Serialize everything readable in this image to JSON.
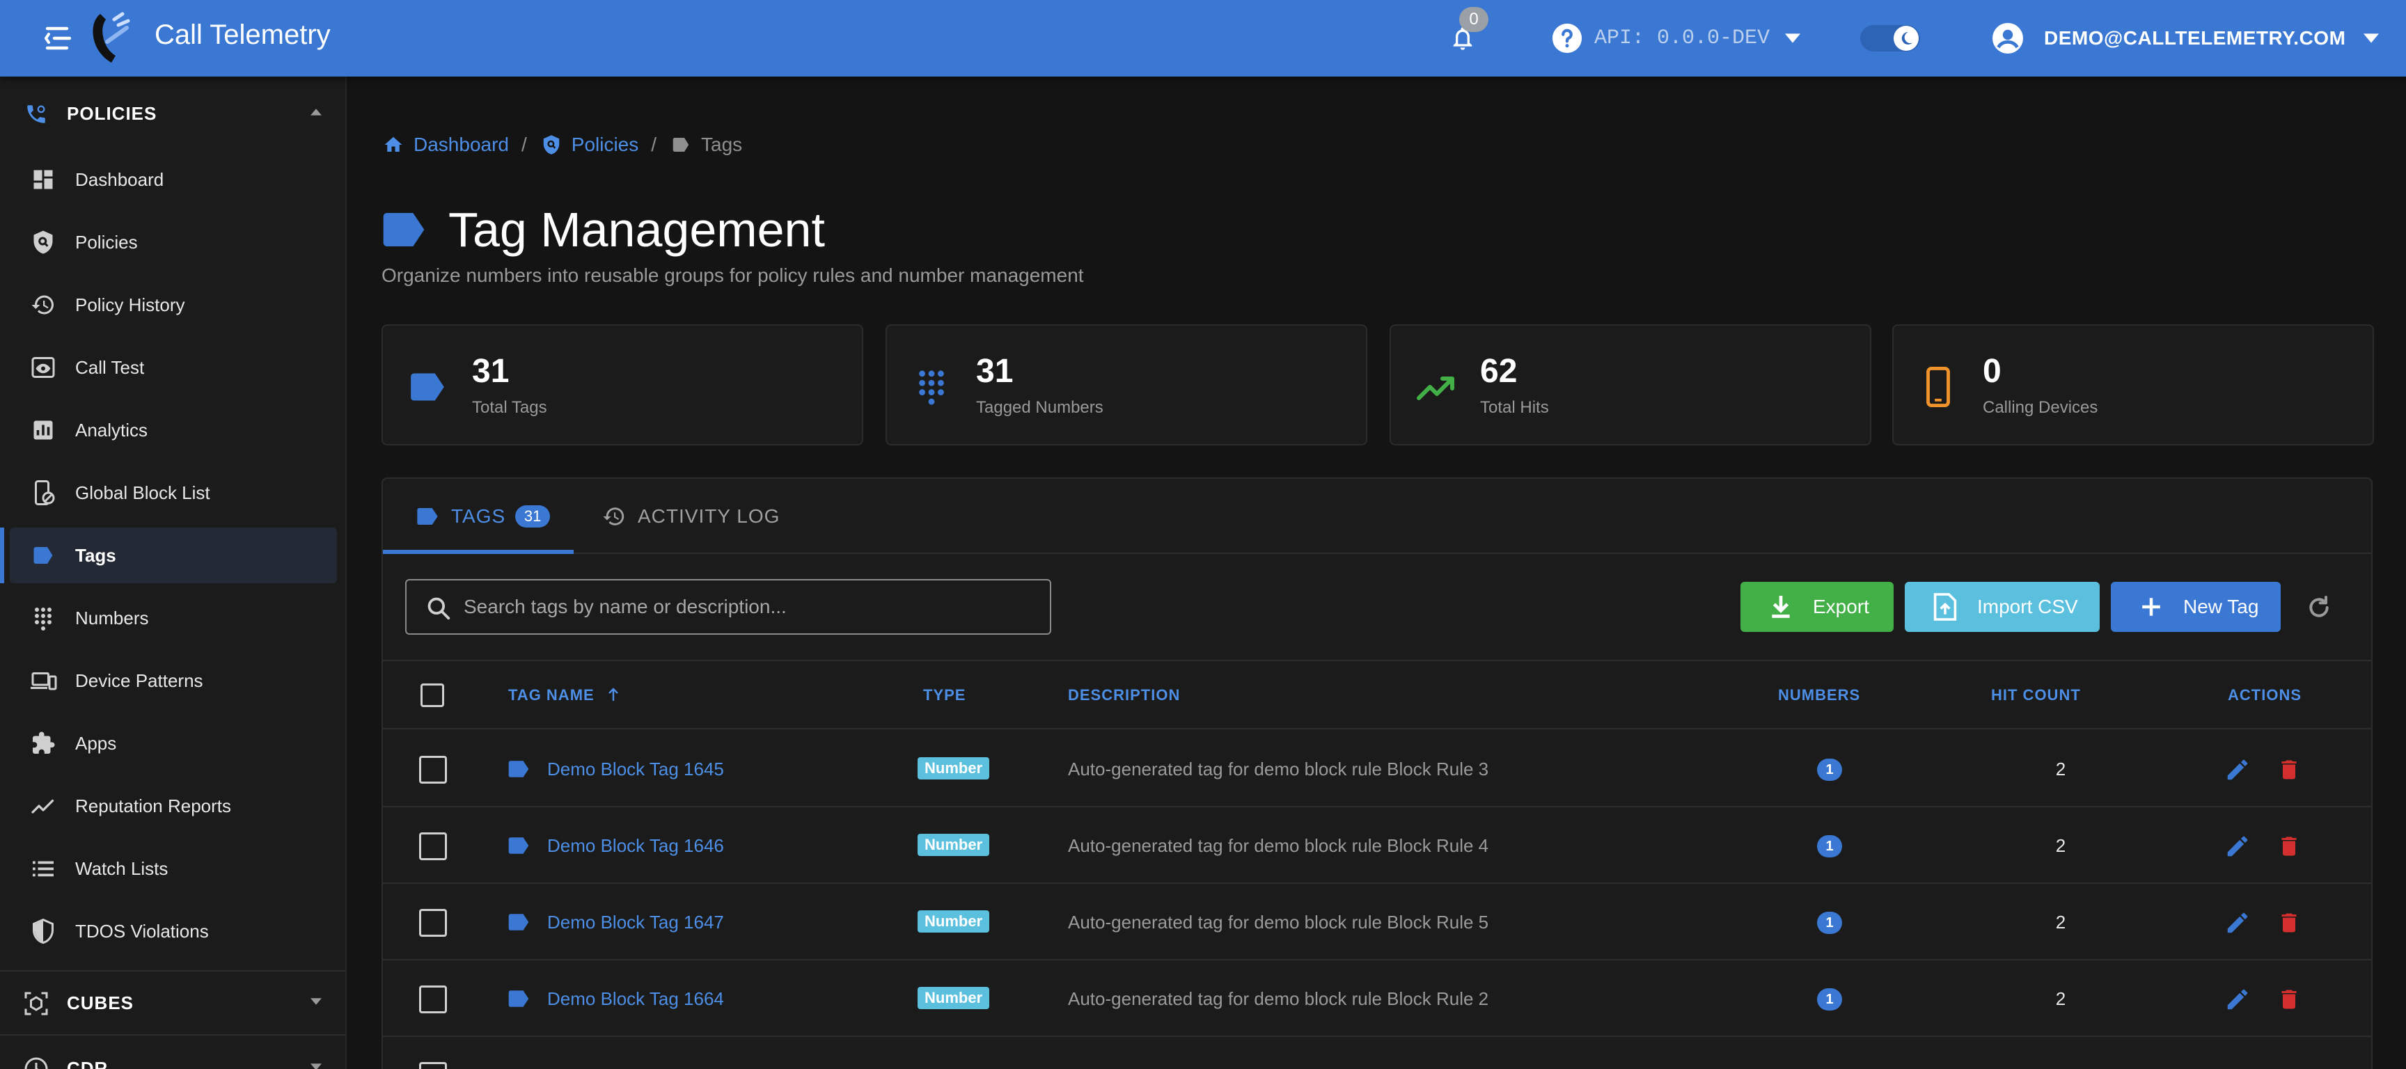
{
  "app": {
    "title": "Call Telemetry",
    "notifications_count": "0",
    "api_version": "API: 0.0.0-DEV",
    "user_email": "DEMO@CALLTELEMETRY.COM",
    "accent_color": "#3a78d4"
  },
  "sidebar": {
    "policies_section": "POLICIES",
    "items": [
      {
        "label": "Dashboard",
        "icon": "dashboard-icon"
      },
      {
        "label": "Policies",
        "icon": "shield-search-icon"
      },
      {
        "label": "Policy History",
        "icon": "history-icon"
      },
      {
        "label": "Call Test",
        "icon": "eye-icon"
      },
      {
        "label": "Analytics",
        "icon": "analytics-icon"
      },
      {
        "label": "Global Block List",
        "icon": "phone-block-icon"
      },
      {
        "label": "Tags",
        "icon": "tag-icon",
        "active": true
      },
      {
        "label": "Numbers",
        "icon": "dialpad-icon"
      },
      {
        "label": "Device Patterns",
        "icon": "devices-icon"
      },
      {
        "label": "Apps",
        "icon": "puzzle-icon"
      },
      {
        "label": "Reputation Reports",
        "icon": "trending-icon"
      },
      {
        "label": "Watch Lists",
        "icon": "list-icon"
      },
      {
        "label": "TDOS Violations",
        "icon": "shield-half-icon"
      }
    ],
    "cubes_section": "CUBES",
    "cdr_section": "CDR"
  },
  "breadcrumb": {
    "dashboard": "Dashboard",
    "policies": "Policies",
    "current": "Tags",
    "separator": "/"
  },
  "page": {
    "title": "Tag Management",
    "subtitle": "Organize numbers into reusable groups for policy rules and number management"
  },
  "stats": [
    {
      "value": "31",
      "label": "Total Tags",
      "icon": "tag-icon",
      "color": "#3a78d4"
    },
    {
      "value": "31",
      "label": "Tagged Numbers",
      "icon": "dialpad-icon",
      "color": "#3a78d4"
    },
    {
      "value": "62",
      "label": "Total Hits",
      "icon": "trending-up-icon",
      "color": "#43b047"
    },
    {
      "value": "0",
      "label": "Calling Devices",
      "icon": "cellphone-icon",
      "color": "#f0932b"
    }
  ],
  "tabs": {
    "tags_label": "TAGS",
    "tags_count": "31",
    "activity_label": "ACTIVITY LOG"
  },
  "toolbar": {
    "search_placeholder": "Search tags by name or description...",
    "export_label": "Export",
    "import_label": "Import CSV",
    "new_label": "New Tag"
  },
  "table": {
    "columns": {
      "tag_name": "TAG NAME",
      "type": "TYPE",
      "description": "DESCRIPTION",
      "numbers": "NUMBERS",
      "hit_count": "HIT COUNT",
      "actions": "ACTIONS"
    },
    "rows": [
      {
        "name": "Demo Block Tag 1645",
        "type": "Number",
        "description": "Auto-generated tag for demo block rule Block Rule 3",
        "numbers": "1",
        "hits": "2"
      },
      {
        "name": "Demo Block Tag 1646",
        "type": "Number",
        "description": "Auto-generated tag for demo block rule Block Rule 4",
        "numbers": "1",
        "hits": "2"
      },
      {
        "name": "Demo Block Tag 1647",
        "type": "Number",
        "description": "Auto-generated tag for demo block rule Block Rule 5",
        "numbers": "1",
        "hits": "2"
      },
      {
        "name": "Demo Block Tag 1664",
        "type": "Number",
        "description": "Auto-generated tag for demo block rule Block Rule 2",
        "numbers": "1",
        "hits": "2"
      }
    ]
  }
}
